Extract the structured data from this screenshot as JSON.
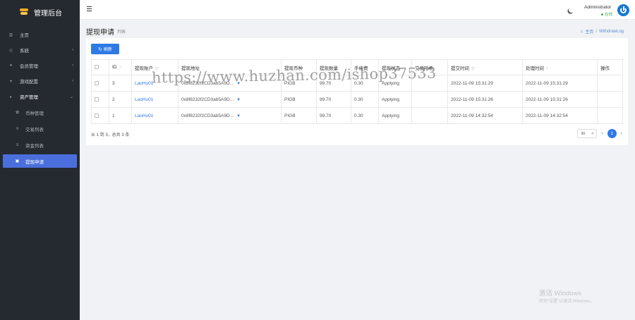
{
  "brand": {
    "title": "管理后台"
  },
  "sidebar": {
    "items": [
      {
        "label": "主页",
        "icon": "dashboard-icon",
        "expandable": false
      },
      {
        "label": "系統",
        "icon": "gear-icon",
        "expandable": true
      },
      {
        "label": "会员管理",
        "icon": "user-icon",
        "expandable": true
      },
      {
        "label": "游戏配置",
        "icon": "gamepad-icon",
        "expandable": true
      },
      {
        "label": "资产管理",
        "icon": "asset-icon",
        "expandable": true,
        "open": true
      }
    ],
    "sub_items": [
      {
        "label": "币种管理",
        "icon": "coin-icon",
        "active": false
      },
      {
        "label": "交易列表",
        "icon": "list-icon",
        "active": false
      },
      {
        "label": "资金列表",
        "icon": "list-icon",
        "active": false
      },
      {
        "label": "提现申请",
        "icon": "withdraw-icon",
        "active": true
      }
    ]
  },
  "header": {
    "user_name": "Administrator",
    "user_status": "在线"
  },
  "page": {
    "title": "提现申请",
    "subtitle": "列表",
    "breadcrumb_home": "主页",
    "breadcrumb_sep": "/",
    "breadcrumb_current": "WithdrawLog"
  },
  "toolbar": {
    "refresh_label": "刷新"
  },
  "table": {
    "columns": [
      "ID",
      "提现账户",
      "提现地址",
      "提现币种",
      "提现数量",
      "手续费",
      "提现状态",
      "交易哈希",
      "提交时间",
      "处理时间",
      "操作"
    ],
    "rows": [
      {
        "id": "3",
        "account": "LaoHu01",
        "address": "0x8f8232f2CD3ab5A9D...",
        "coin": "PIGB",
        "amount": "99.70",
        "fee": "0.30",
        "status": "Applying",
        "hash": "",
        "submitted": "2022-11-09 15:31:29",
        "processed": "2022-11-09 15:31:29"
      },
      {
        "id": "2",
        "account": "LaoHu01",
        "address": "0x8f8232f2CD3ab5A9D...",
        "coin": "PIGB",
        "amount": "99.70",
        "fee": "0.30",
        "status": "Applying",
        "hash": "",
        "submitted": "2022-11-09 15:31:26",
        "processed": "2022-11-09 15:31:26"
      },
      {
        "id": "1",
        "account": "LaoHu01",
        "address": "0x8f8232f2CD3ab5A9D...",
        "coin": "PIGB",
        "amount": "99.70",
        "fee": "0.30",
        "status": "Applying",
        "hash": "",
        "submitted": "2022-11-09 14:32:54",
        "processed": "2022-11-09 14:32:54"
      }
    ]
  },
  "footer": {
    "summary": "从 1 到 3，总共 3 条",
    "page_size": "30",
    "current_page": "1"
  },
  "watermarks": {
    "url": "https://www.huzhan.com/ishop37533",
    "activate_title": "激活 Windows",
    "activate_sub": "转到\"设置\"以激活 Windows。"
  }
}
